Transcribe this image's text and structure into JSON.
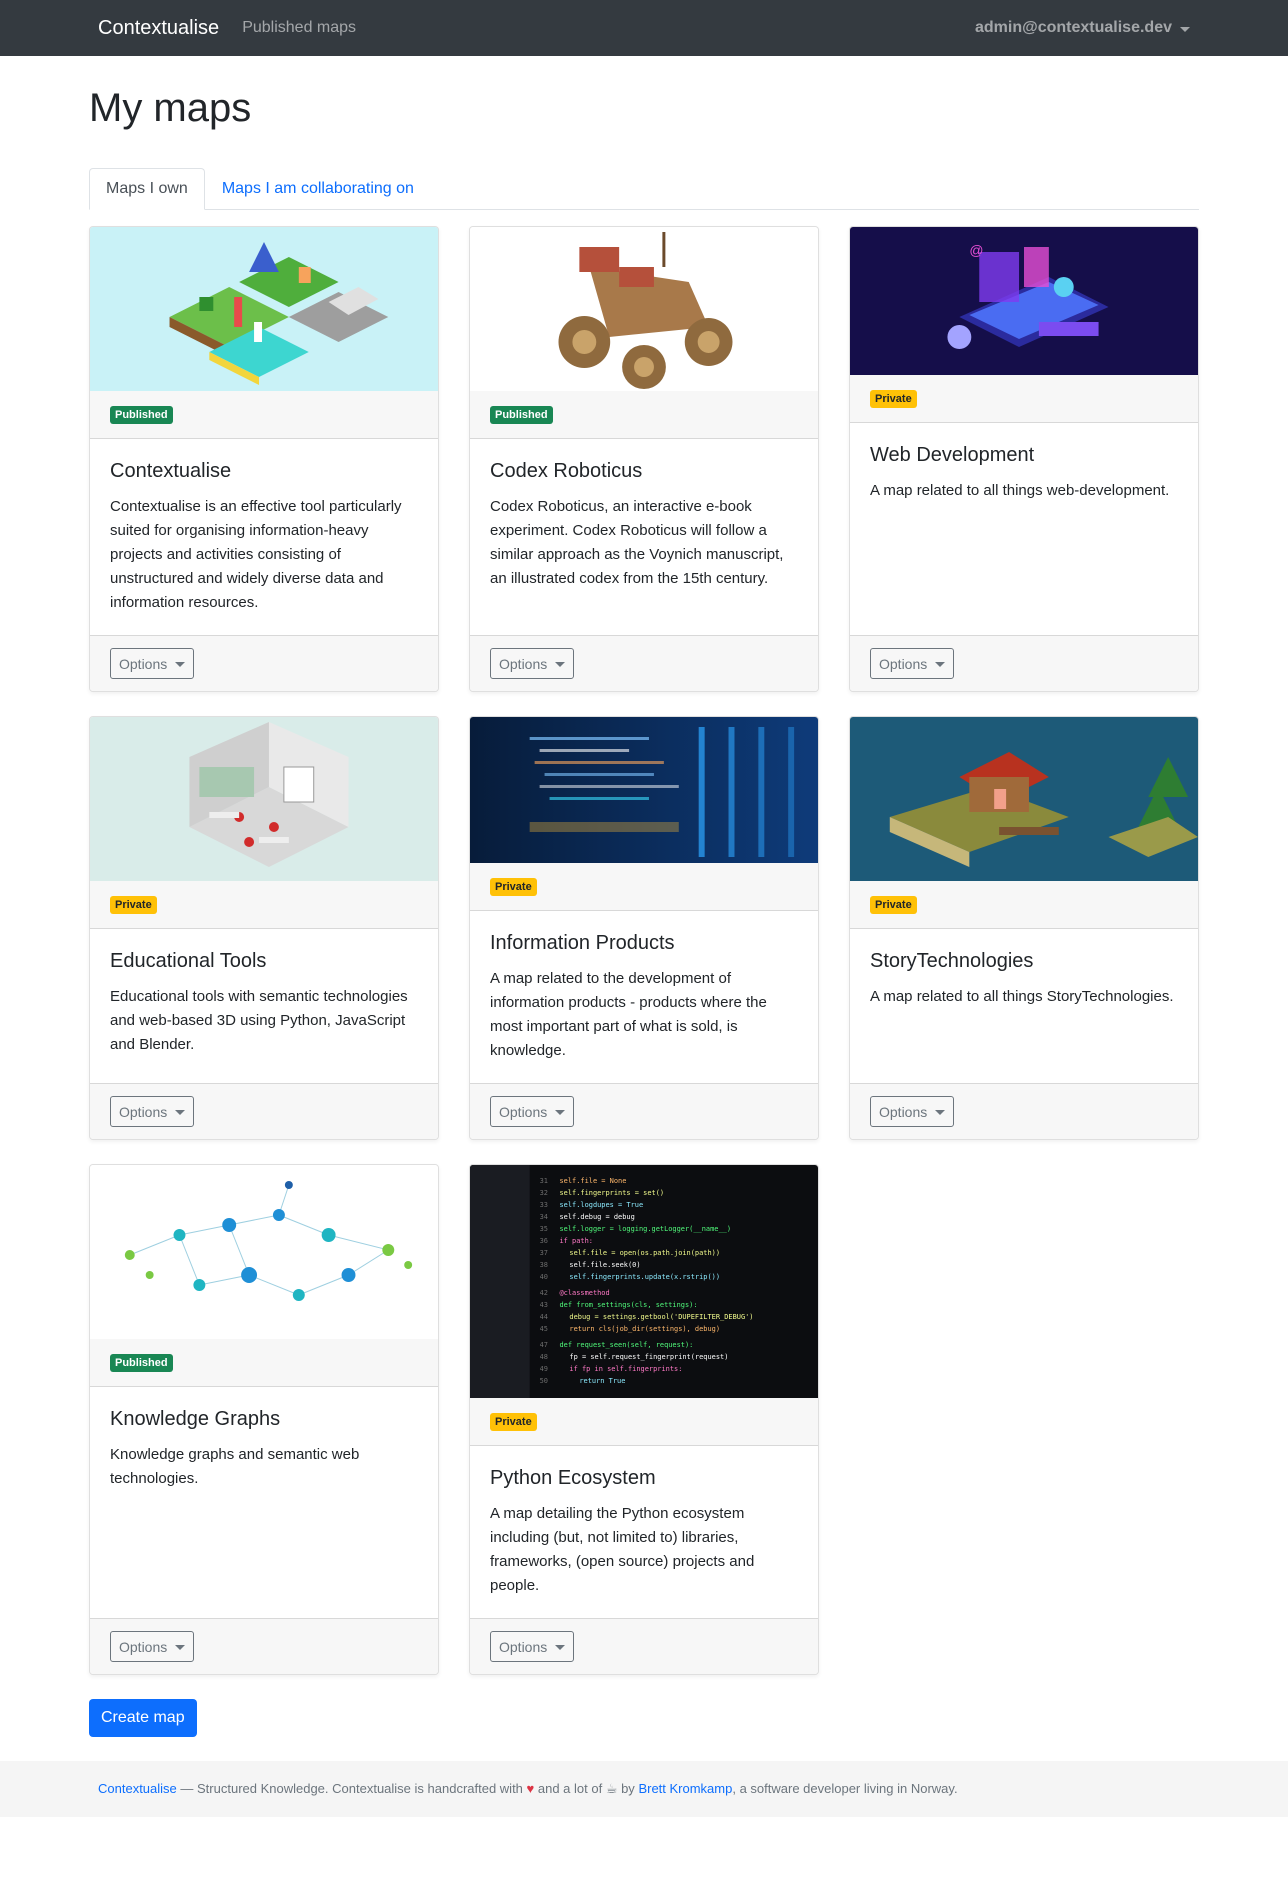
{
  "navbar": {
    "brand": "Contextualise",
    "published_maps": "Published maps",
    "user": "admin@contextualise.dev"
  },
  "page": {
    "title": "My maps"
  },
  "tabs": {
    "owned": "Maps I own",
    "collaborating": "Maps I am collaborating on"
  },
  "cards": [
    {
      "badge": "Published",
      "title": "Contextualise",
      "text": "Contextualise is an effective tool particularly suited for organising information-heavy projects and activities consisting of unstructured and widely diverse data and information resources.",
      "options": "Options"
    },
    {
      "badge": "Published",
      "title": "Codex Roboticus",
      "text": "Codex Roboticus, an interactive e-book experiment. Codex Roboticus will follow a similar approach as the Voynich manuscript, an illustrated codex from the 15th century.",
      "options": "Options"
    },
    {
      "badge": "Private",
      "title": "Web Development",
      "text": "A map related to all things web-development.",
      "options": "Options"
    },
    {
      "badge": "Private",
      "title": "Educational Tools",
      "text": "Educational tools with semantic technologies and web-based 3D using Python, JavaScript and Blender.",
      "options": "Options"
    },
    {
      "badge": "Private",
      "title": "Information Products",
      "text": "A map related to the development of information products - products where the most important part of what is sold, is knowledge.",
      "options": "Options"
    },
    {
      "badge": "Private",
      "title": "StoryTechnologies",
      "text": "A map related to all things StoryTechnologies.",
      "options": "Options"
    },
    {
      "badge": "Published",
      "title": "Knowledge Graphs",
      "text": "Knowledge graphs and semantic web technologies.",
      "options": "Options"
    },
    {
      "badge": "Private",
      "title": "Python Ecosystem",
      "text": "A map detailing the Python ecosystem including (but, not limited to) libraries, frameworks, (open source) projects and people.",
      "options": "Options"
    }
  ],
  "create_button": "Create map",
  "footer": {
    "link1": "Contextualise",
    "text1": " — Structured Knowledge. Contextualise is handcrafted with ",
    "heart": "♥",
    "text2": " and a lot of ",
    "coffee": "☕",
    "text3": " by ",
    "link2": "Brett Kromkamp",
    "text4": ", a software developer living in Norway."
  },
  "colors": {
    "navbar": "#343a40",
    "primary": "#0d6efd",
    "published": "#198754",
    "private": "#ffc107"
  }
}
